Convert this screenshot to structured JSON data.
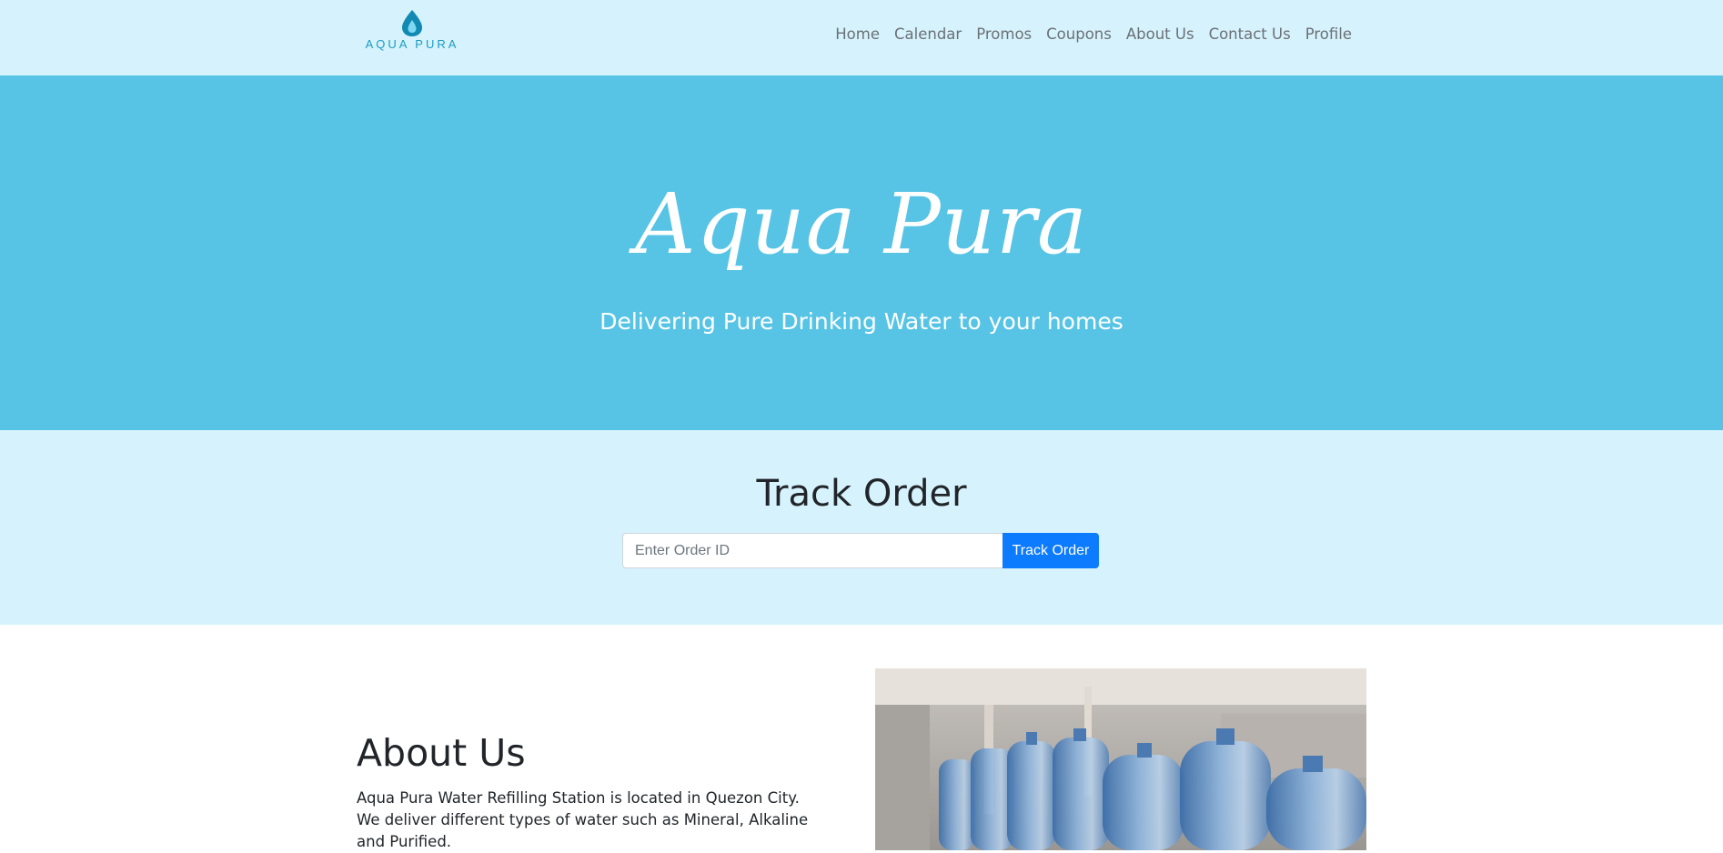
{
  "brand": {
    "name": "AQUA PURA",
    "logo_icon": "water-drop-icon",
    "color": "#1a9bc2"
  },
  "nav": {
    "items": [
      {
        "label": "Home"
      },
      {
        "label": "Calendar"
      },
      {
        "label": "Promos"
      },
      {
        "label": "Coupons"
      },
      {
        "label": "About Us"
      },
      {
        "label": "Contact Us"
      },
      {
        "label": "Profile"
      }
    ]
  },
  "hero": {
    "title": "Aqua Pura",
    "subtitle": "Delivering Pure Drinking Water to your homes",
    "background": "#57c4e5"
  },
  "track": {
    "title": "Track Order",
    "input_placeholder": "Enter Order ID",
    "input_value": "",
    "button_label": "Track Order",
    "button_color": "#0d7bfd"
  },
  "about": {
    "title": "About Us",
    "text": "Aqua Pura Water Refilling Station is located in Quezon City. We deliver different types of water such as Mineral, Alkaline and Purified.",
    "image": "water-bottles-photo"
  }
}
